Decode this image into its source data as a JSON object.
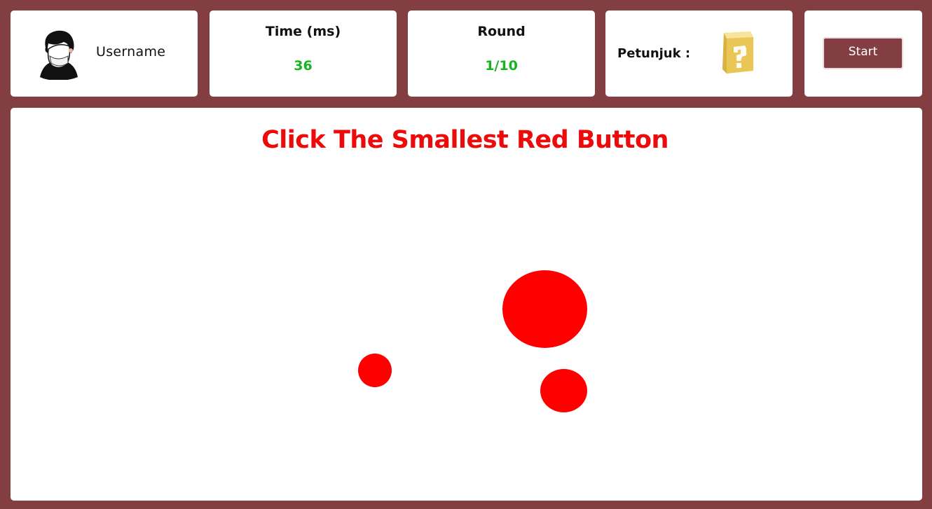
{
  "header": {
    "user": {
      "username": "Username"
    },
    "time": {
      "title": "Time (ms)",
      "value": "36"
    },
    "round": {
      "title": "Round",
      "value": "1/10"
    },
    "hint": {
      "label": "Petunjuk :",
      "icon": "question-block-icon"
    },
    "start_label": "Start"
  },
  "game": {
    "instruction": "Click The Smallest Red Button",
    "targets": [
      {
        "name": "large-red-button",
        "color": "#ff0000"
      },
      {
        "name": "medium-red-button",
        "color": "#ff0000"
      },
      {
        "name": "small-red-button",
        "color": "#ff0000"
      }
    ]
  },
  "colors": {
    "background": "#833e41",
    "accent": "#833e41",
    "value_green": "#14b51c",
    "instruction_red": "#ed0a0a",
    "target_red": "#ff0000"
  }
}
